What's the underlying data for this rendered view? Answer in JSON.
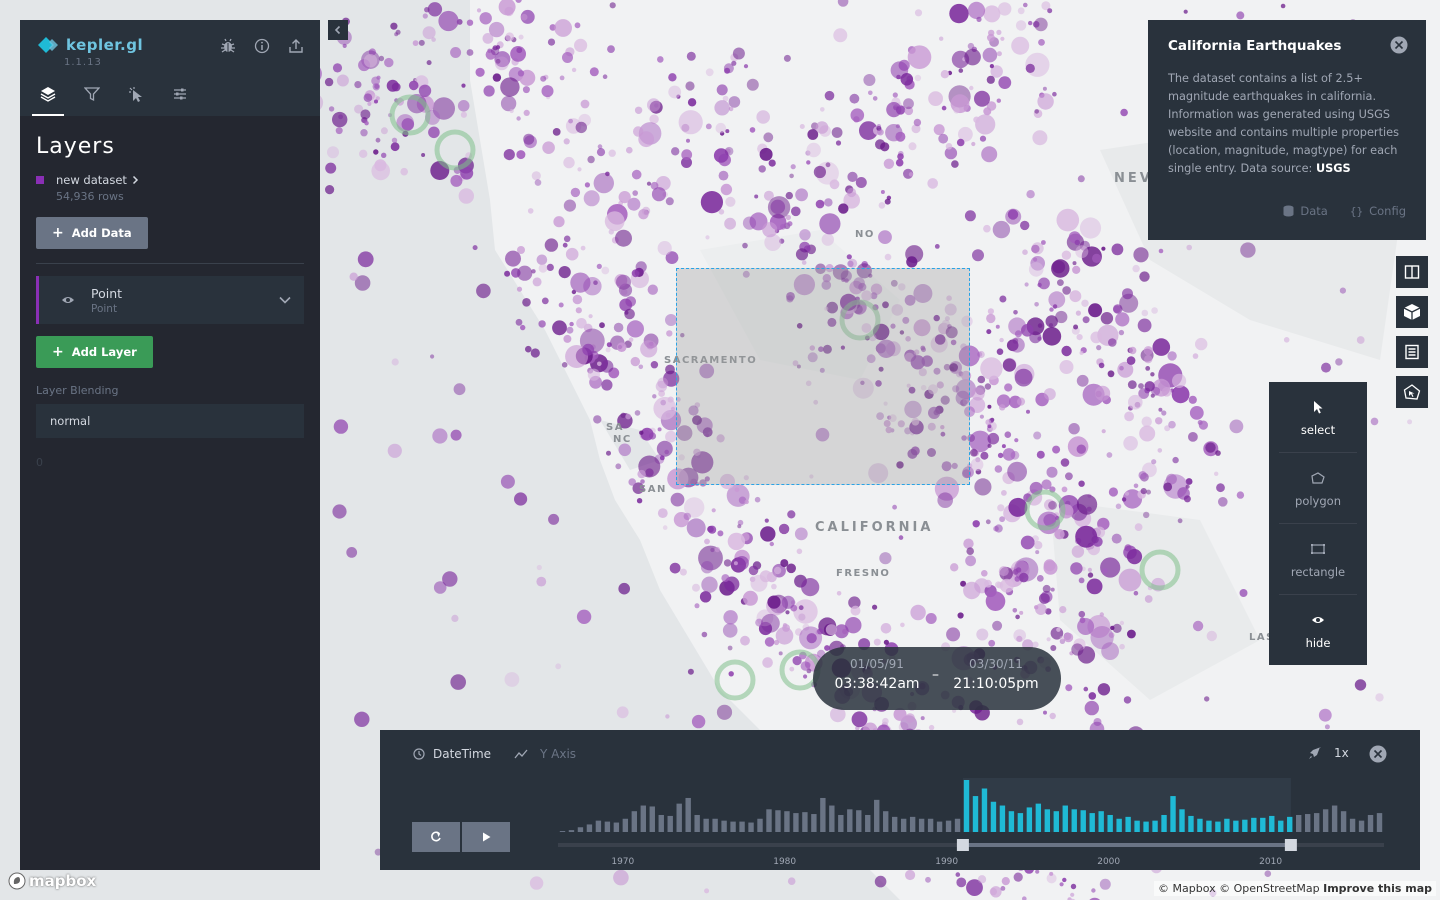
{
  "app": {
    "name": "kepler.gl",
    "version": "1.1.13"
  },
  "side_panel": {
    "title": "Layers",
    "tabs": [
      "layer-icon",
      "filter-icon",
      "interaction-icon",
      "map-settings-icon"
    ],
    "dataset": {
      "name": "new dataset",
      "rows": "54,936 rows",
      "color": "#8a2fb5"
    },
    "add_data_label": "Add Data",
    "layer": {
      "name": "Point",
      "type": "Point"
    },
    "add_layer_label": "Add Layer",
    "blending_label": "Layer Blending",
    "blending_value": "normal",
    "stray_text": "0"
  },
  "info_panel": {
    "title": "California Earthquakes",
    "description_parts": {
      "body": "The dataset contains a list of 2.5+ magnitude earthquakes in california. Information was generated using USGS website and contains multiple properties (location, magnitude, magtype) for each single entry. Data source: ",
      "source": "USGS"
    },
    "data_label": "Data",
    "config_label": "Config"
  },
  "map_labels": {
    "sacramento": "SACRAMENTO",
    "california": "CALIFORNIA",
    "fresno": "FRESNO",
    "nevada_partial": "NEV",
    "las_partial": "LAS",
    "no_partial": "NO",
    "san_partial_1": "SA",
    "san_partial_2": "NC",
    "san_partial_3": "SAN"
  },
  "draw_menu": {
    "items": [
      {
        "label": "select",
        "icon": "cursor-icon"
      },
      {
        "label": "polygon",
        "icon": "polygon-icon"
      },
      {
        "label": "rectangle",
        "icon": "rectangle-icon"
      },
      {
        "label": "hide",
        "icon": "eye-icon"
      }
    ]
  },
  "time_readout": {
    "start_date": "01/05/91",
    "start_time": "03:38:42am",
    "end_date": "03/30/11",
    "end_time": "21:10:05pm",
    "separator": "–"
  },
  "time_panel": {
    "field_label": "DateTime",
    "y_axis_label": "Y Axis",
    "speed_label": "1x",
    "x_ticks": [
      "1970",
      "1980",
      "1990",
      "2000",
      "2010"
    ]
  },
  "chart_data": {
    "type": "bar",
    "xlim": [
      1966,
      2017
    ],
    "x_ticks": [
      "1970",
      "1980",
      "1990",
      "2000",
      "2010"
    ],
    "selection": [
      1991.0,
      2011.25
    ],
    "colors": {
      "selected": "#1fbad6",
      "unselected": "#6a7485"
    },
    "values": [
      1,
      2,
      5,
      8,
      12,
      11,
      10,
      14,
      22,
      28,
      27,
      18,
      17,
      30,
      36,
      18,
      14,
      14,
      12,
      11,
      11,
      10,
      14,
      24,
      23,
      22,
      20,
      21,
      19,
      36,
      28,
      18,
      24,
      23,
      18,
      34,
      22,
      16,
      14,
      16,
      14,
      14,
      11,
      12,
      14,
      55,
      38,
      46,
      32,
      28,
      22,
      20,
      26,
      30,
      24,
      22,
      28,
      24,
      23,
      20,
      22,
      18,
      14,
      16,
      12,
      11,
      12,
      18,
      38,
      24,
      17,
      14,
      12,
      11,
      14,
      12,
      13,
      15,
      15,
      17,
      12,
      16,
      18,
      19,
      20,
      24,
      28,
      22,
      14,
      12,
      18,
      20
    ]
  },
  "attribution": {
    "mapbox_logo": "mapbox",
    "text": "© Mapbox © OpenStreetMap",
    "improve": "Improve this map"
  }
}
